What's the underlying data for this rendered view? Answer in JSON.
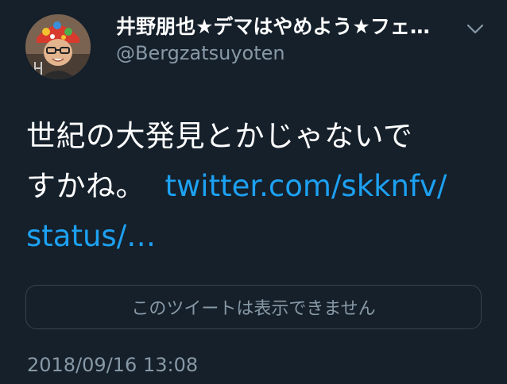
{
  "tweet": {
    "display_name": "井野朋也★デマはやめよう★フェ…",
    "handle": "@Bergzatsuyoten",
    "text_line1": "世紀の大発見とかじゃないで",
    "text_line2": "すかね。",
    "link_part1": "twitter.com/skknfv/",
    "link_part2": "status/…",
    "unavailable_notice": "このツイートは表示できません",
    "timestamp": "2018/09/16 13:08"
  },
  "icons": {
    "menu": "chevron-down-icon",
    "avatar": "profile-photo"
  },
  "colors": {
    "background": "#15202b",
    "primary_text": "#ffffff",
    "secondary_text": "#8899a6",
    "link": "#1da1f2",
    "border": "#38444d"
  }
}
